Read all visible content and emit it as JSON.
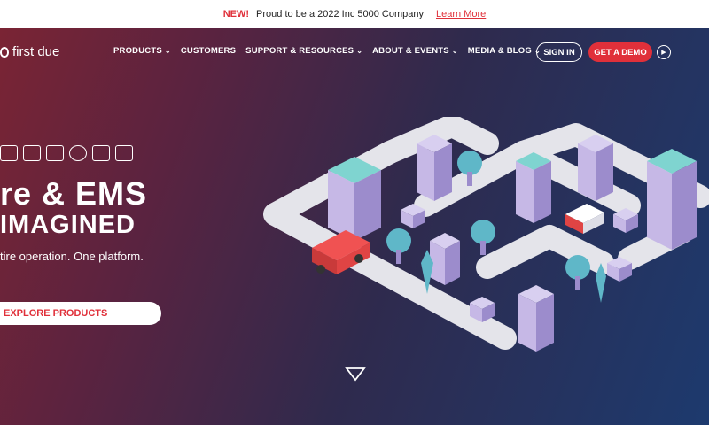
{
  "announcement": {
    "badge": "NEW!",
    "text": "Proud to be a 2022 Inc 5000 Company",
    "link": "Learn More"
  },
  "brand": {
    "name": "first due"
  },
  "nav": {
    "items": [
      {
        "label": "PRODUCTS",
        "dropdown": true
      },
      {
        "label": "CUSTOMERS",
        "dropdown": false
      },
      {
        "label": "SUPPORT & RESOURCES",
        "dropdown": true
      },
      {
        "label": "ABOUT & EVENTS",
        "dropdown": true
      },
      {
        "label": "MEDIA & BLOG",
        "dropdown": true
      }
    ],
    "sign_in": "SIGN IN",
    "demo": "GET A DEMO"
  },
  "hero": {
    "line1": "re & EMS",
    "line2": "IMAGINED",
    "subtitle": "tire operation. One platform.",
    "cta": "EXPLORE PRODUCTS"
  },
  "colors": {
    "accent": "#e0303a",
    "gradient_start": "#7a2434",
    "gradient_end": "#1d3a6e"
  }
}
